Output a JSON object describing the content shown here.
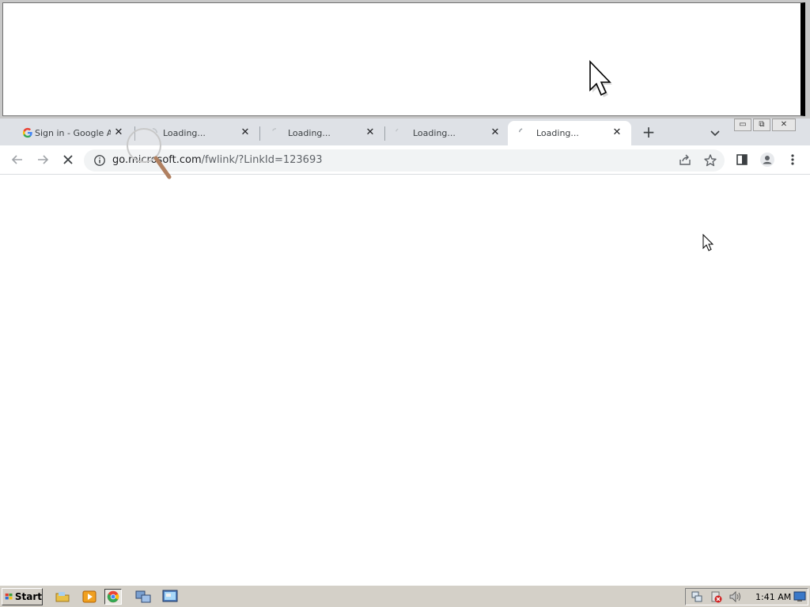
{
  "tabs": [
    {
      "label": "Sign in - Google Acc",
      "favicon": "google-g-icon",
      "active": false
    },
    {
      "label": "Loading...",
      "favicon": "spinner-icon",
      "active": false
    },
    {
      "label": "Loading...",
      "favicon": "spinner-icon",
      "active": false
    },
    {
      "label": "Loading...",
      "favicon": "spinner-icon",
      "active": false
    },
    {
      "label": "Loading...",
      "favicon": "spinner-icon",
      "active": true
    }
  ],
  "tab_close_glyph": "✕",
  "new_tab_glyph": "+",
  "window_buttons": {
    "minimize": "▭",
    "restore": "⧉",
    "close": "✕"
  },
  "address_bar": {
    "host": "go.microsoft.com",
    "path": "/fwlink/?LinkId=123693"
  },
  "taskbar": {
    "start_label": "Start",
    "clock": "1:41 AM",
    "quick_launch": [
      "explorer-icon",
      "media-player-icon",
      "chrome-icon",
      "network-icon",
      "remote-desktop-icon"
    ]
  },
  "colors": {
    "tab_strip": "#dee1e6",
    "omnibox": "#f1f3f4",
    "taskbar": "#d4d0c8",
    "google_blue": "#4285f4",
    "google_red": "#ea4335",
    "google_yellow": "#fbbc05",
    "google_green": "#34a853"
  }
}
